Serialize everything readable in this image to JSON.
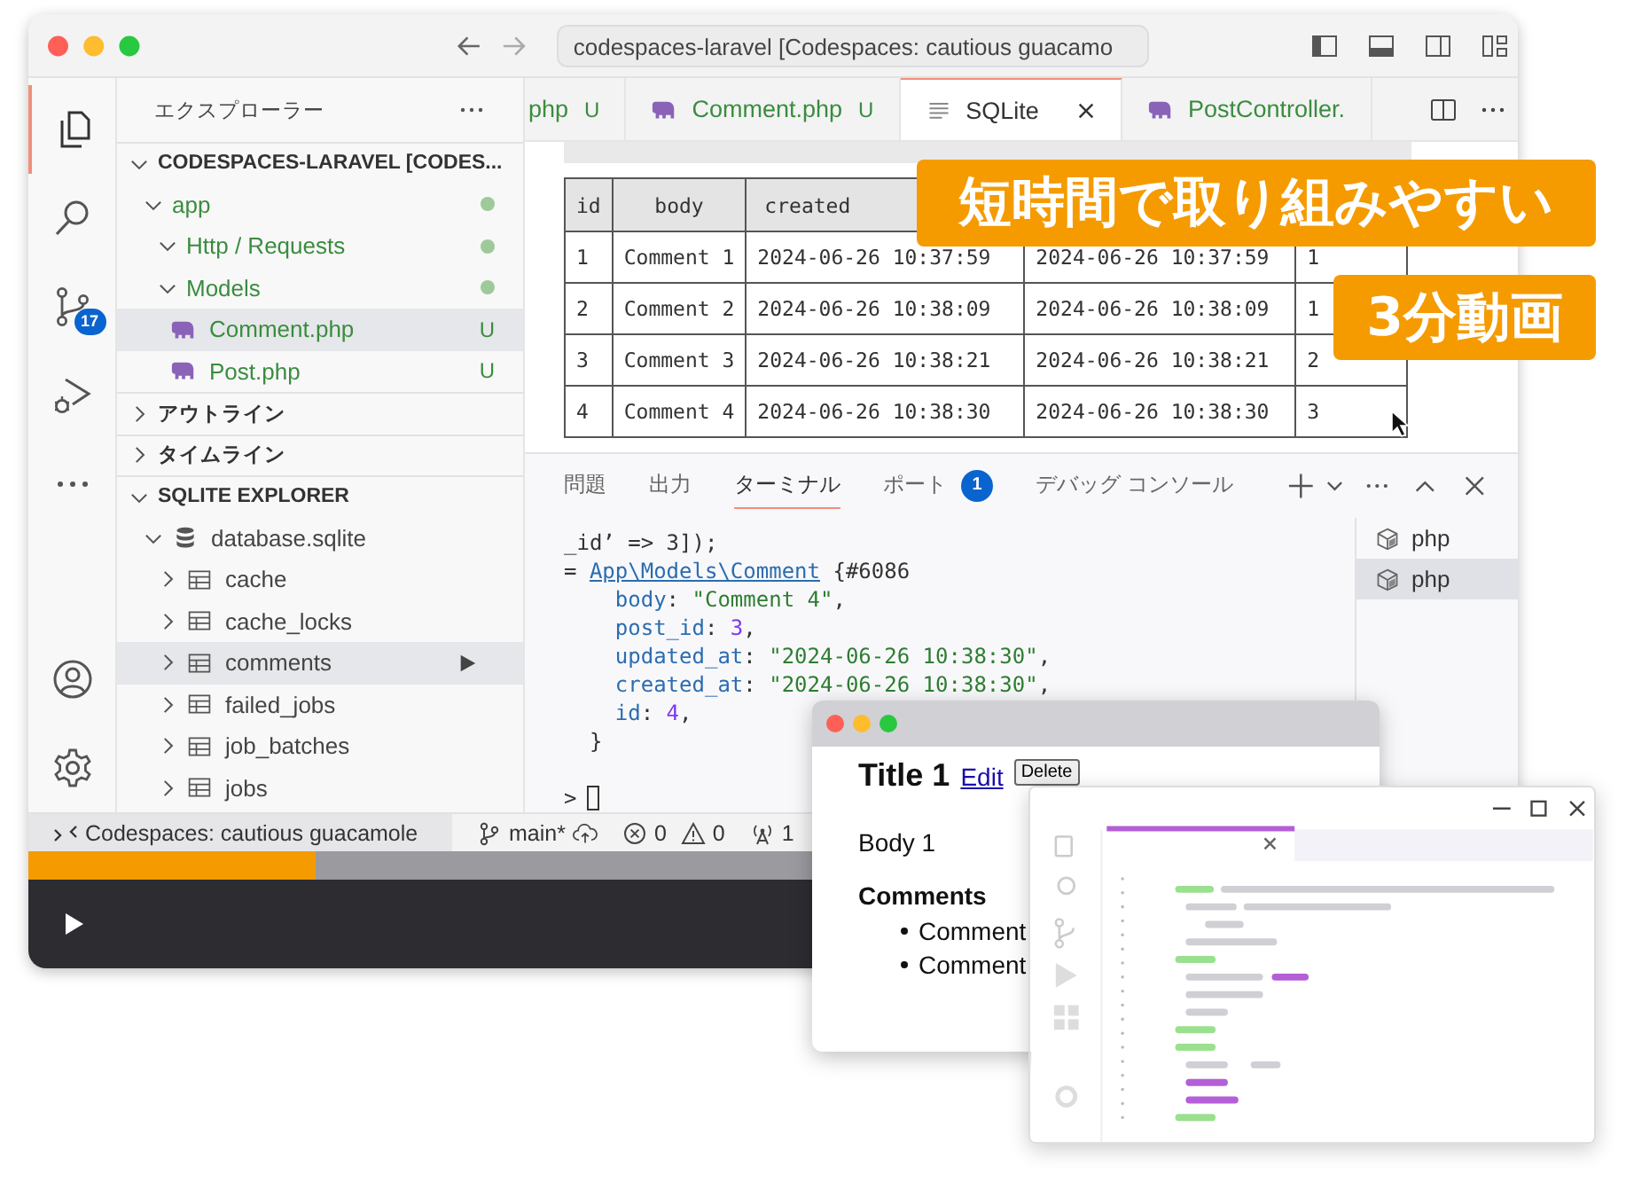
{
  "window": {
    "address": "codespaces-laravel [Codespaces: cautious guacamo"
  },
  "activity_bar": {
    "source_control_badge": "17"
  },
  "sidebar": {
    "title": "エクスプローラー",
    "tree": [
      {
        "label": "CODESPACES-LARAVEL [CODES...",
        "kind": "section",
        "expanded": true,
        "children": [
          {
            "label": "app",
            "kind": "folder",
            "expanded": true,
            "modified": true,
            "selected": false,
            "children": [
              {
                "label": "Http / Requests",
                "kind": "folder",
                "expanded": true,
                "modified": true,
                "selected": false
              },
              {
                "label": "Models",
                "kind": "folder",
                "expanded": true,
                "modified": true,
                "selected": false,
                "children": [
                  {
                    "label": "Comment.php",
                    "kind": "php",
                    "status": "U",
                    "selected": true
                  },
                  {
                    "label": "Post.php",
                    "kind": "php",
                    "status": "U",
                    "selected": false
                  }
                ]
              }
            ]
          }
        ]
      },
      {
        "label": "アウトライン",
        "kind": "section",
        "expanded": false
      },
      {
        "label": "タイムライン",
        "kind": "section",
        "expanded": false
      },
      {
        "label": "SQLITE EXPLORER",
        "kind": "section",
        "expanded": true,
        "children": [
          {
            "label": "database.sqlite",
            "kind": "database",
            "expanded": true,
            "selected": false,
            "children": [
              {
                "label": "cache",
                "kind": "table",
                "expanded": false,
                "selected": false
              },
              {
                "label": "cache_locks",
                "kind": "table",
                "expanded": false,
                "selected": false
              },
              {
                "label": "comments",
                "kind": "table",
                "expanded": false,
                "selected": true,
                "run_icon": true
              },
              {
                "label": "failed_jobs",
                "kind": "table",
                "expanded": false,
                "selected": false
              },
              {
                "label": "job_batches",
                "kind": "table",
                "expanded": false,
                "selected": false
              },
              {
                "label": "jobs",
                "kind": "table",
                "expanded": false,
                "selected": false
              }
            ]
          }
        ]
      }
    ]
  },
  "editor": {
    "tabs": [
      {
        "label": "php",
        "kind": "text",
        "status": "U",
        "selected": false
      },
      {
        "label": "Comment.php",
        "kind": "php",
        "status": "U",
        "selected": false
      },
      {
        "label": "SQLite",
        "kind": "sqlite",
        "selected": true
      },
      {
        "label": "PostController.",
        "kind": "php",
        "selected": false
      }
    ],
    "table": {
      "columns": [
        "id",
        "body",
        "created"
      ],
      "rows": [
        [
          "1",
          "Comment 1",
          "2024-06-26 10:37:59",
          "2024-06-26 10:37:59",
          "1"
        ],
        [
          "2",
          "Comment 2",
          "2024-06-26 10:38:09",
          "2024-06-26 10:38:09",
          "1"
        ],
        [
          "3",
          "Comment 3",
          "2024-06-26 10:38:21",
          "2024-06-26 10:38:21",
          "2"
        ],
        [
          "4",
          "Comment 4",
          "2024-06-26 10:38:30",
          "2024-06-26 10:38:30",
          "3"
        ]
      ]
    }
  },
  "panel": {
    "tabs": [
      {
        "label": "問題",
        "selected": false
      },
      {
        "label": "出力",
        "selected": false
      },
      {
        "label": "ターミナル",
        "selected": true
      },
      {
        "label": "ポート",
        "selected": false,
        "badge": "1"
      },
      {
        "label": "デバッグ コンソール",
        "selected": false
      }
    ],
    "terminal_lines": [
      {
        "segments": [
          {
            "text": "_id’ => 3]);",
            "kind": "plain"
          }
        ]
      },
      {
        "segments": [
          {
            "text": "= ",
            "kind": "plain"
          },
          {
            "text": "App\\Models\\Comment",
            "kind": "link"
          },
          {
            "text": " {#6086",
            "kind": "plain"
          }
        ],
        "close": "}",
        "children": [
          {
            "segments": [
              {
                "text": "body",
                "kind": "key"
              },
              {
                "text": ": ",
                "kind": "plain"
              },
              {
                "text": "\"Comment 4\"",
                "kind": "string"
              },
              {
                "text": ",",
                "kind": "plain"
              }
            ]
          },
          {
            "segments": [
              {
                "text": "post_id",
                "kind": "key"
              },
              {
                "text": ": ",
                "kind": "plain"
              },
              {
                "text": "3",
                "kind": "number"
              },
              {
                "text": ",",
                "kind": "plain"
              }
            ]
          },
          {
            "segments": [
              {
                "text": "updated_at",
                "kind": "key"
              },
              {
                "text": ": ",
                "kind": "plain"
              },
              {
                "text": "\"2024-06-26 10:38:30\"",
                "kind": "string"
              },
              {
                "text": ",",
                "kind": "plain"
              }
            ]
          },
          {
            "segments": [
              {
                "text": "created_at",
                "kind": "key"
              },
              {
                "text": ": ",
                "kind": "plain"
              },
              {
                "text": "\"2024-06-26 10:38:30\"",
                "kind": "string"
              },
              {
                "text": ",",
                "kind": "plain"
              }
            ]
          },
          {
            "segments": [
              {
                "text": "id",
                "kind": "key"
              },
              {
                "text": ": ",
                "kind": "plain"
              },
              {
                "text": "4",
                "kind": "number"
              },
              {
                "text": ",",
                "kind": "plain"
              }
            ]
          }
        ]
      }
    ],
    "prompt": ">",
    "terminals": [
      {
        "label": "php",
        "selected": false
      },
      {
        "label": "php",
        "selected": true
      }
    ]
  },
  "status_bar": {
    "remote": "Codespaces: cautious guacamole",
    "branch": "main*",
    "errors": "0",
    "warnings": "0",
    "ports": "1"
  },
  "player": {
    "progress": {
      "level": 0.193
    }
  },
  "badges": [
    "短時間で取り組みやすい",
    "3分動画"
  ],
  "preview_window": {
    "title": "Title 1",
    "edit": "Edit",
    "delete": "Delete",
    "body": "Body 1",
    "heading": "Comments",
    "comments": [
      "Comment",
      "Comment"
    ]
  }
}
